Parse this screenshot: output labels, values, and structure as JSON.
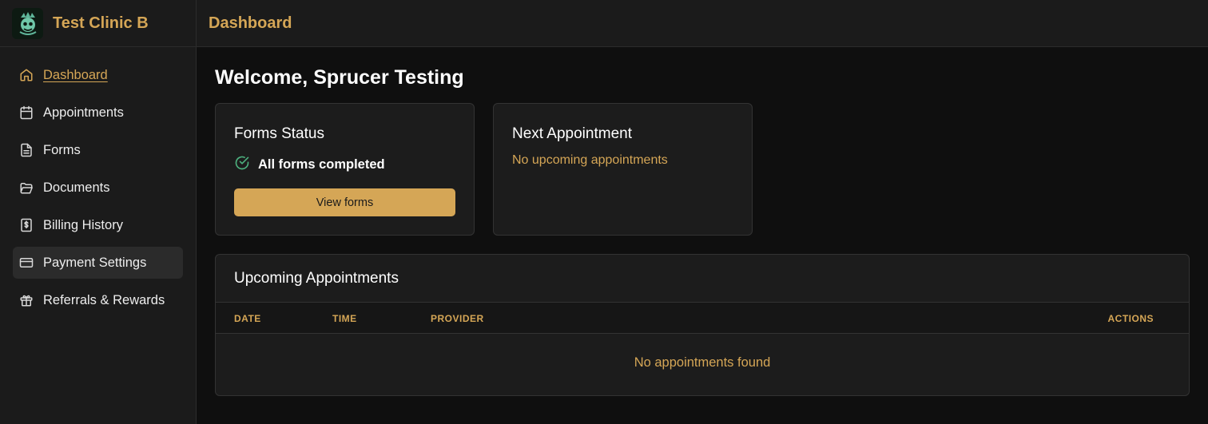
{
  "brand": {
    "name": "Test Clinic B"
  },
  "sidebar": {
    "items": [
      {
        "label": "Dashboard",
        "icon": "home-icon"
      },
      {
        "label": "Appointments",
        "icon": "calendar-icon"
      },
      {
        "label": "Forms",
        "icon": "document-icon"
      },
      {
        "label": "Documents",
        "icon": "folder-icon"
      },
      {
        "label": "Billing History",
        "icon": "receipt-icon"
      },
      {
        "label": "Payment Settings",
        "icon": "credit-card-icon"
      },
      {
        "label": "Referrals & Rewards",
        "icon": "gift-icon"
      }
    ]
  },
  "header": {
    "title": "Dashboard"
  },
  "main": {
    "welcome": "Welcome, Sprucer Testing",
    "forms_card": {
      "title": "Forms Status",
      "status": "All forms completed",
      "button": "View forms"
    },
    "next_card": {
      "title": "Next Appointment",
      "empty": "No upcoming appointments"
    },
    "upcoming": {
      "title": "Upcoming Appointments",
      "columns": [
        "DATE",
        "TIME",
        "PROVIDER",
        "ACTIONS"
      ],
      "empty": "No appointments found"
    }
  },
  "colors": {
    "accent": "#d5a656",
    "background": "#0f0f0f",
    "panel": "#1b1b1b",
    "success": "#4caf7d"
  }
}
